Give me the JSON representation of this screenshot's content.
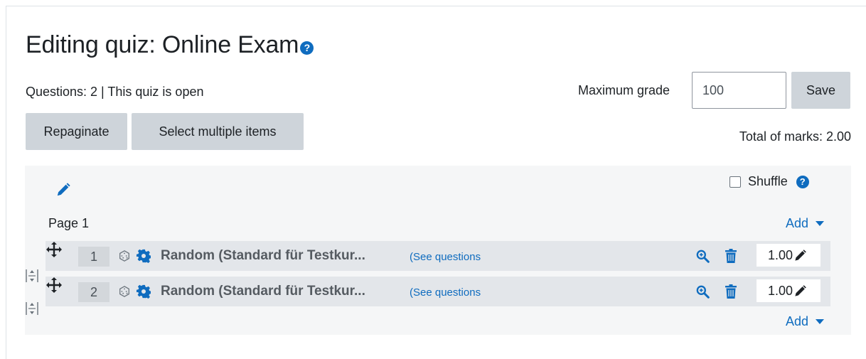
{
  "header": {
    "title": "Editing quiz: Online Exam",
    "help_glyph": "?",
    "status": "Questions: 2 | This quiz is open"
  },
  "grade": {
    "label": "Maximum grade",
    "value": "100",
    "save_label": "Save"
  },
  "toolbar": {
    "repaginate_label": "Repaginate",
    "select_multiple_label": "Select multiple items",
    "total_marks": "Total of marks: 2.00"
  },
  "section": {
    "shuffle_label": "Shuffle",
    "shuffle_checked": false,
    "page_label": "Page 1",
    "add_label": "Add",
    "add_bottom_label": "Add"
  },
  "questions": [
    {
      "number": "1",
      "name": "Random (Standard für Testkur...",
      "see_questions": "(See questions",
      "mark": "1.00"
    },
    {
      "number": "2",
      "name": "Random (Standard für Testkur...",
      "see_questions": "(See questions",
      "mark": "1.00"
    }
  ],
  "icons": {
    "help": "help-icon",
    "edit": "pencil-icon",
    "move": "move-icon",
    "dice": "dice-icon",
    "settings": "gear-icon",
    "preview": "zoom-in-icon",
    "delete": "trash-icon",
    "page_break": "page-break-icon",
    "dropdown": "caret-down-icon"
  },
  "colors": {
    "link": "#0f6cbf",
    "button_bg": "#ced4da",
    "section_bg": "#f5f6f7",
    "row_bg": "#e3e6ea",
    "text": "#1d2125"
  }
}
